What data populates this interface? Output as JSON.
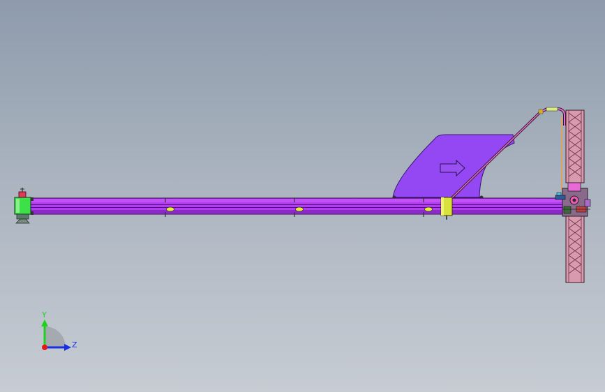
{
  "viewport": {
    "background_top": "#8e9bac",
    "background_bottom": "#c7ccd3"
  },
  "triad": {
    "y_label": "Y",
    "z_label": "Z",
    "y_color": "#1fd11f",
    "z_color": "#1a2fe0",
    "x_color": "#e01a1a"
  },
  "model": {
    "beam_color": "#b33cf2",
    "beam_dark": "#6e1aa8",
    "fin_color": "#9448f4",
    "arrow_icon": "right-arrow-icon",
    "tower_color": "#d79aae",
    "end_cap_color": "#3ee04a",
    "collar_color": "#d8e23a",
    "marker_color": "#e6f23a"
  }
}
